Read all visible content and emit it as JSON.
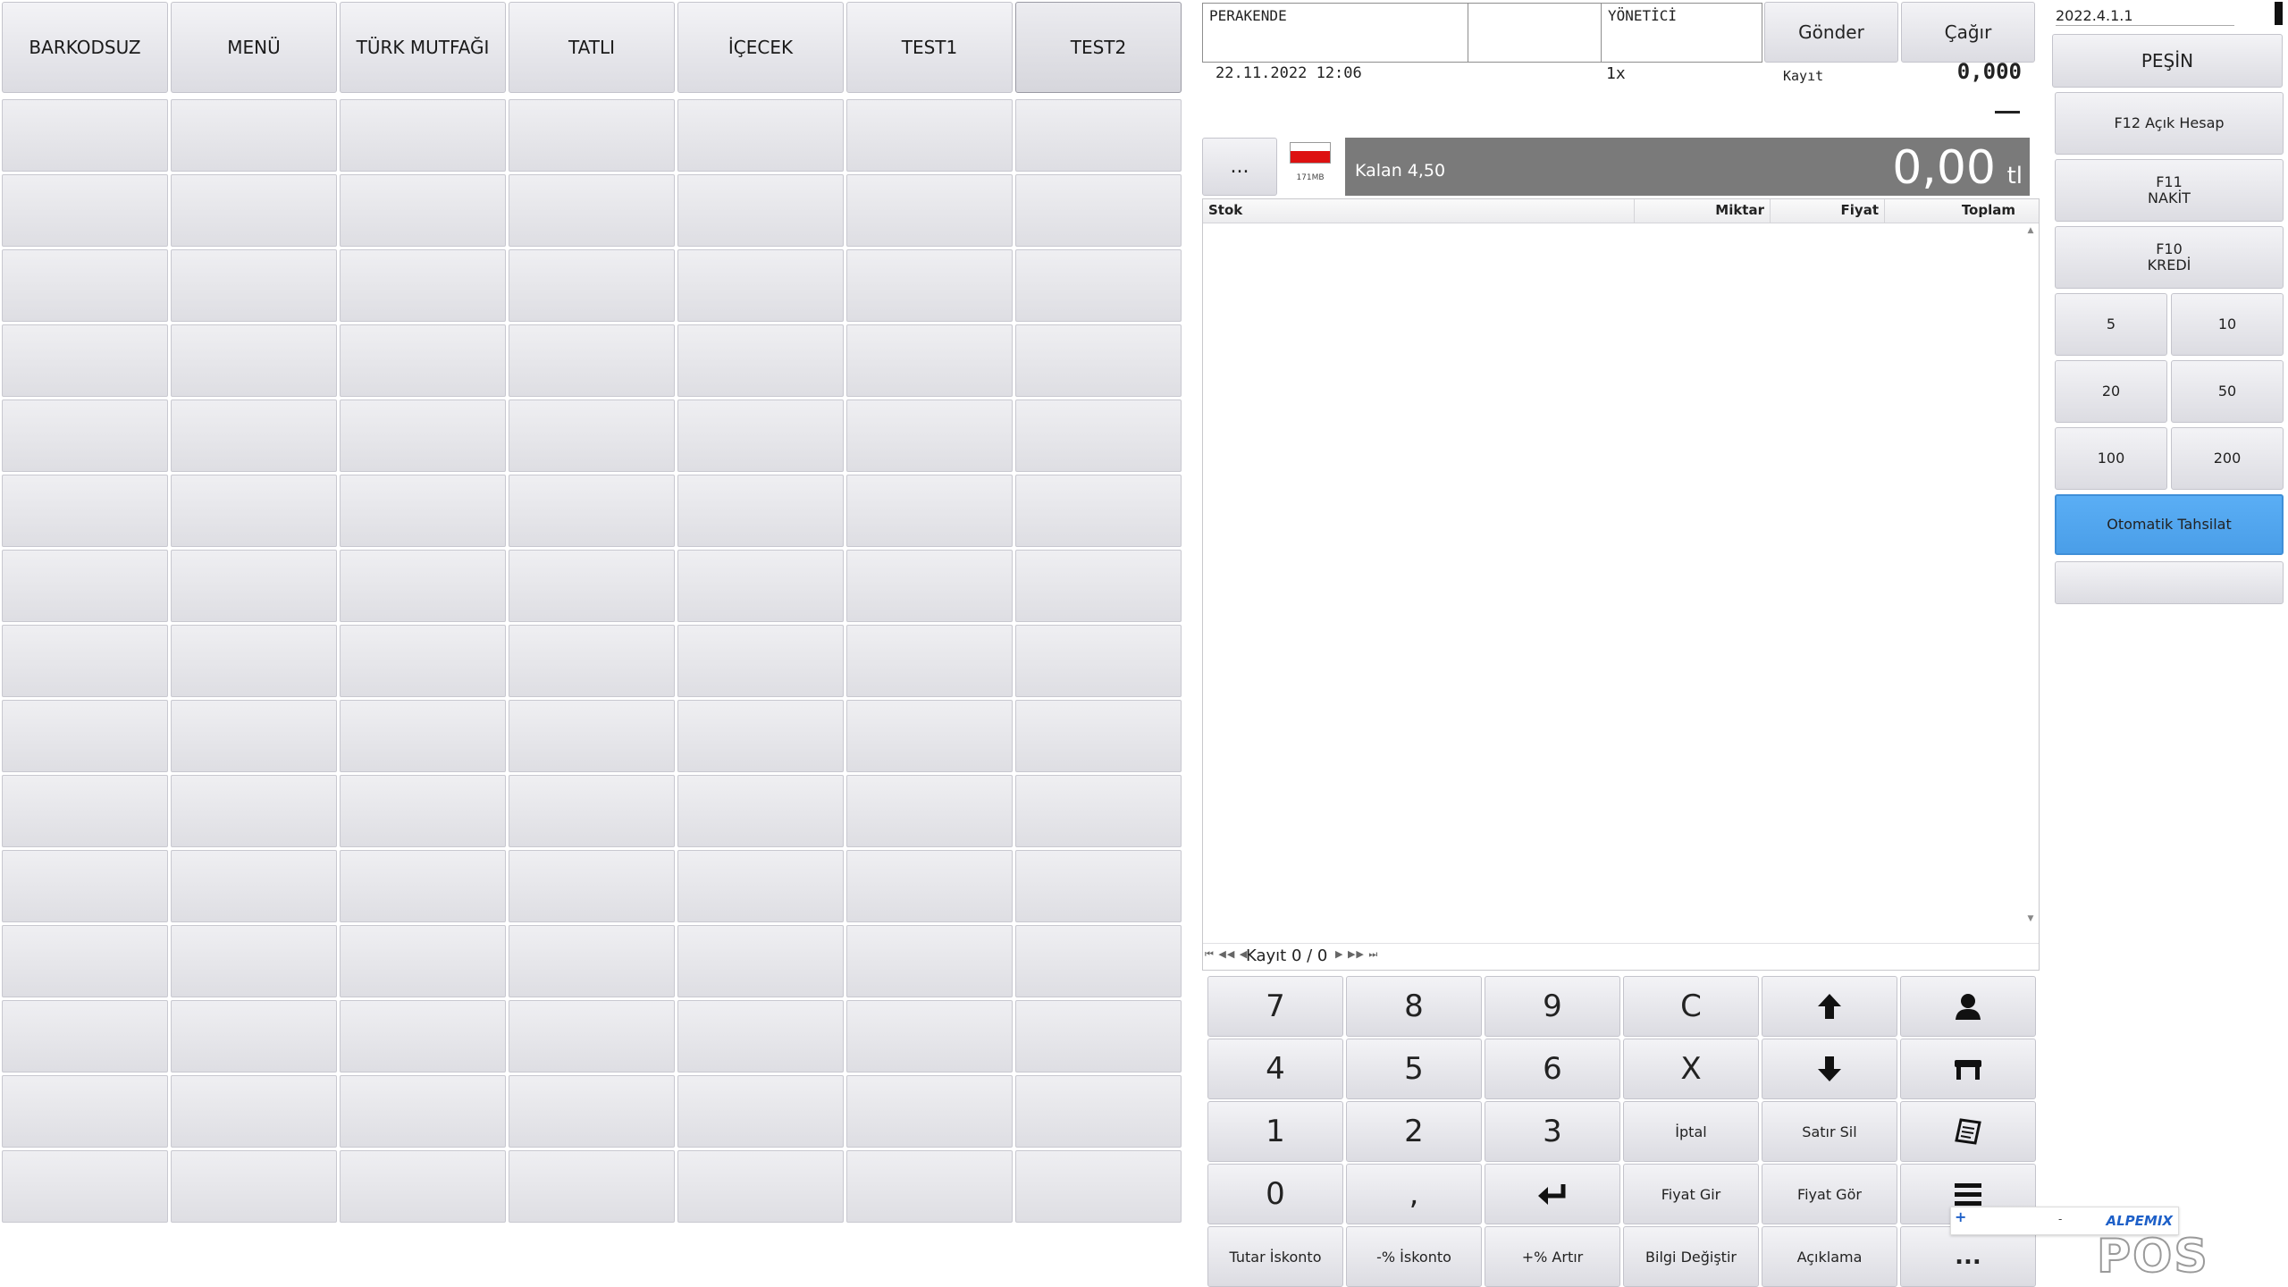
{
  "categories": [
    "BARKODSUZ",
    "MENÜ",
    "TÜRK MUTFAĞI",
    "TATLI",
    "İÇECEK",
    "TEST1",
    "TEST2"
  ],
  "active_category": "TEST2",
  "header": {
    "customer": "PERAKENDE",
    "blank_field": "",
    "user": "YÖNETİCİ",
    "send_label": "Gönder",
    "call_label": "Çağır",
    "datetime": "22.11.2022 12:06",
    "multiplier": "1x",
    "record_label": "Kayıt",
    "record_value": "0,000",
    "dash": "—"
  },
  "more_button": "...",
  "memory_label": "171MB",
  "remaining_label": "Kalan 4,50",
  "total": {
    "amount": "0,00",
    "currency": "tl"
  },
  "grid": {
    "columns": [
      "Stok",
      "Miktar",
      "Fiyat",
      "Toplam"
    ],
    "navigator": "Kayıt 0 / 0"
  },
  "numpad": [
    "7",
    "8",
    "9",
    "C",
    "",
    "",
    "4",
    "5",
    "6",
    "X",
    "",
    "",
    "1",
    "2",
    "3",
    "İptal",
    "Satır Sil",
    "",
    "0",
    ",",
    "",
    "Fiyat Gir",
    "Fiyat Gör",
    "",
    "Tutar İskonto",
    "-% İskonto",
    "+% Artır",
    "Bilgi Değiştir",
    "Açıklama",
    "..."
  ],
  "numpad_icons": [
    "",
    "",
    "",
    "",
    "arrow-up-icon",
    "user-icon",
    "",
    "",
    "",
    "",
    "arrow-down-icon",
    "table-icon",
    "",
    "",
    "",
    "",
    "",
    "receipt-icon",
    "",
    "",
    "enter-icon",
    "",
    "",
    "menu-icon",
    "",
    "",
    "",
    "",
    "",
    ""
  ],
  "payment": {
    "version": "2022.4.1.1",
    "cash_label": "PEŞİN",
    "f12": "F12 Açık Hesap",
    "f11_key": "F11",
    "f11_label": "NAKİT",
    "f10_key": "F10",
    "f10_label": "KREDİ",
    "denominations": [
      "5",
      "10",
      "20",
      "50",
      "100",
      "200"
    ],
    "auto_collect": "Otomatik Tahsilat",
    "highlight_color": "#5aaef5"
  },
  "brand": {
    "pos": "POS",
    "alpemix": "ALPEMIX"
  }
}
